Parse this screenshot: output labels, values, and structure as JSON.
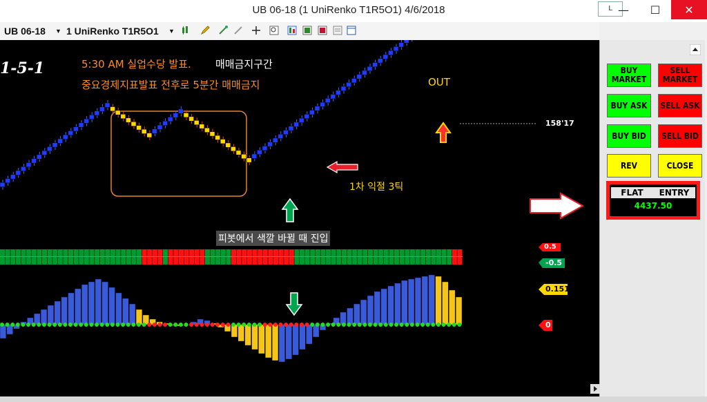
{
  "window": {
    "title": "UB 06-18 (1 UniRenko T1R5O1)  4/6/2018",
    "l_button": "L",
    "minimize": "—",
    "maximize": "☐",
    "close": "✕"
  },
  "toolbar": {
    "instrument": "UB 06-18",
    "period": "1 UniRenko T1R5O1"
  },
  "chart": {
    "corner_label": "1-5-1",
    "note_line1_part1": "5:30 AM 실업수당 발표.",
    "note_line1_part2": "매매금지구간",
    "note_line2": "중요경제지표발표 전후로 5분간 매매금지",
    "out_label": "OUT",
    "price_label": "158'17",
    "profit_label": "1차 익절 3틱",
    "pivot_label": "피봇에서 색깔 바뀔 때 진입",
    "badge_1": "0.5",
    "badge_2": "-0.5",
    "badge_3": "0.151",
    "badge_4": "0"
  },
  "sidebar": {
    "buy_market": "BUY MARKET",
    "sell_market": "SELL MARKET",
    "buy_ask": "BUY ASK",
    "sell_ask": "SELL ASK",
    "buy_bid": "BUY BID",
    "sell_bid": "SELL BID",
    "rev": "REV",
    "close": "CLOSE",
    "position_status": "FLAT",
    "entry_label": "ENTRY",
    "entry_price": "4437.50"
  },
  "colors": {
    "up_brick": "#1f3bff",
    "down_brick": "#ffd700",
    "histo_up": "#3a5bd9",
    "histo_down": "#f5c518",
    "bar_green": "#009a2e",
    "bar_red": "#ff1010",
    "annotation_orange": "#ff8c1a",
    "annotation_yellow": "#ffd700"
  }
}
